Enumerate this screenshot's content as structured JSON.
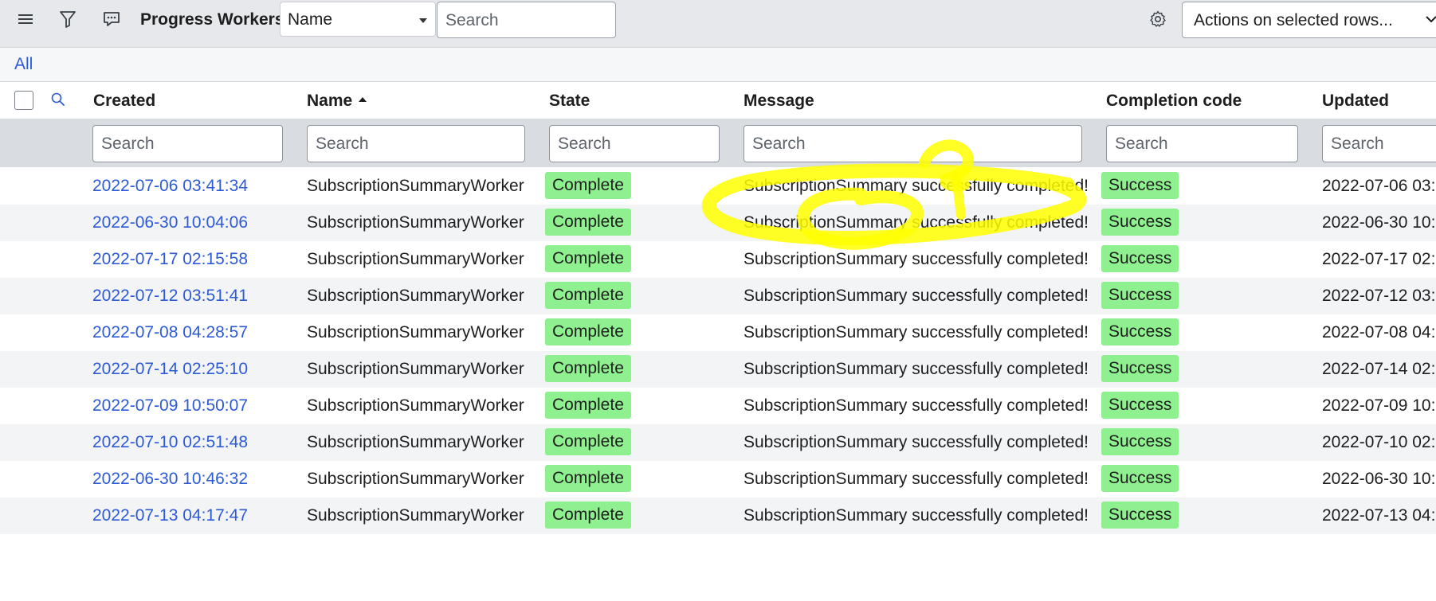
{
  "header": {
    "title": "Progress Workers",
    "field_select": "Name",
    "search_placeholder": "Search",
    "actions_label": "Actions on selected rows..."
  },
  "subbar": {
    "all_label": "All"
  },
  "columns": [
    "Created",
    "Name",
    "State",
    "Message",
    "Completion code",
    "Updated"
  ],
  "column_search_placeholder": "Search",
  "sort": {
    "column": "Name",
    "direction": "ascending"
  },
  "rows": [
    {
      "created": "2022-07-06 03:41:34",
      "name": "SubscriptionSummaryWorker",
      "state": "Complete",
      "message": "SubscriptionSummary successfully completed!",
      "code": "Success",
      "updated": "2022-07-06 03:"
    },
    {
      "created": "2022-06-30 10:04:06",
      "name": "SubscriptionSummaryWorker",
      "state": "Complete",
      "message": "SubscriptionSummary successfully completed!",
      "code": "Success",
      "updated": "2022-06-30 10:"
    },
    {
      "created": "2022-07-17 02:15:58",
      "name": "SubscriptionSummaryWorker",
      "state": "Complete",
      "message": "SubscriptionSummary successfully completed!",
      "code": "Success",
      "updated": "2022-07-17 02:"
    },
    {
      "created": "2022-07-12 03:51:41",
      "name": "SubscriptionSummaryWorker",
      "state": "Complete",
      "message": "SubscriptionSummary successfully completed!",
      "code": "Success",
      "updated": "2022-07-12 03:"
    },
    {
      "created": "2022-07-08 04:28:57",
      "name": "SubscriptionSummaryWorker",
      "state": "Complete",
      "message": "SubscriptionSummary successfully completed!",
      "code": "Success",
      "updated": "2022-07-08 04:"
    },
    {
      "created": "2022-07-14 02:25:10",
      "name": "SubscriptionSummaryWorker",
      "state": "Complete",
      "message": "SubscriptionSummary successfully completed!",
      "code": "Success",
      "updated": "2022-07-14 02:"
    },
    {
      "created": "2022-07-09 10:50:07",
      "name": "SubscriptionSummaryWorker",
      "state": "Complete",
      "message": "SubscriptionSummary successfully completed!",
      "code": "Success",
      "updated": "2022-07-09 10:"
    },
    {
      "created": "2022-07-10 02:51:48",
      "name": "SubscriptionSummaryWorker",
      "state": "Complete",
      "message": "SubscriptionSummary successfully completed!",
      "code": "Success",
      "updated": "2022-07-10 02:"
    },
    {
      "created": "2022-06-30 10:46:32",
      "name": "SubscriptionSummaryWorker",
      "state": "Complete",
      "message": "SubscriptionSummary successfully completed!",
      "code": "Success",
      "updated": "2022-06-30 10:"
    },
    {
      "created": "2022-07-13 04:17:47",
      "name": "SubscriptionSummaryWorker",
      "state": "Complete",
      "message": "SubscriptionSummary successfully completed!",
      "code": "Success",
      "updated": "2022-07-13 04:"
    }
  ],
  "icons": {
    "menu": "hamburger-menu-icon",
    "filter": "funnel-filter-icon",
    "activity": "chat-bubble-icon",
    "settings": "gear-icon",
    "column_search": "magnifier-icon"
  },
  "colors": {
    "link": "#2d5ad6",
    "badge_green": "#8ef08e",
    "highlight_scribble": "#ffff00",
    "header_bg": "#e6e8ec"
  }
}
